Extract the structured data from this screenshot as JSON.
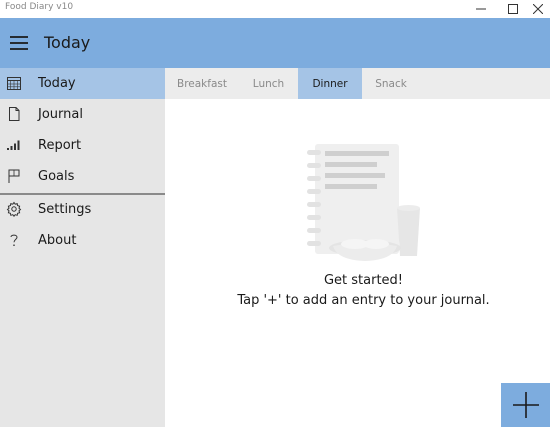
{
  "window": {
    "title": "Food Diary v10",
    "controls": [
      "minimize-icon",
      "maximize-icon",
      "close-icon"
    ]
  },
  "appbar": {
    "menu_icon": "hamburger-icon",
    "title": "Today",
    "color": "#7dacde"
  },
  "sidebar": {
    "items": [
      {
        "label": "Today",
        "icon": "calendar-icon",
        "selected": true
      },
      {
        "label": "Journal",
        "icon": "document-icon",
        "selected": false
      },
      {
        "label": "Report",
        "icon": "bar-chart-icon",
        "selected": false
      },
      {
        "label": "Goals",
        "icon": "flag-icon",
        "selected": false
      },
      {
        "label": "Settings",
        "icon": "gear-icon",
        "selected": false
      },
      {
        "label": "About",
        "icon": "question-icon",
        "selected": false
      }
    ]
  },
  "tabs": {
    "items": [
      "Breakfast",
      "Lunch",
      "Dinner",
      "Snack"
    ],
    "selected": "Dinner"
  },
  "empty_state": {
    "illustration": "notebook-cup-icon",
    "title": "Get started!",
    "subtitle": "Tap '+' to add an entry to your journal."
  },
  "fab": {
    "icon": "plus-icon"
  },
  "colors": {
    "accent": "#7dacde",
    "selection": "#a5c4e6",
    "sidebar_bg": "#e6e6e6"
  }
}
